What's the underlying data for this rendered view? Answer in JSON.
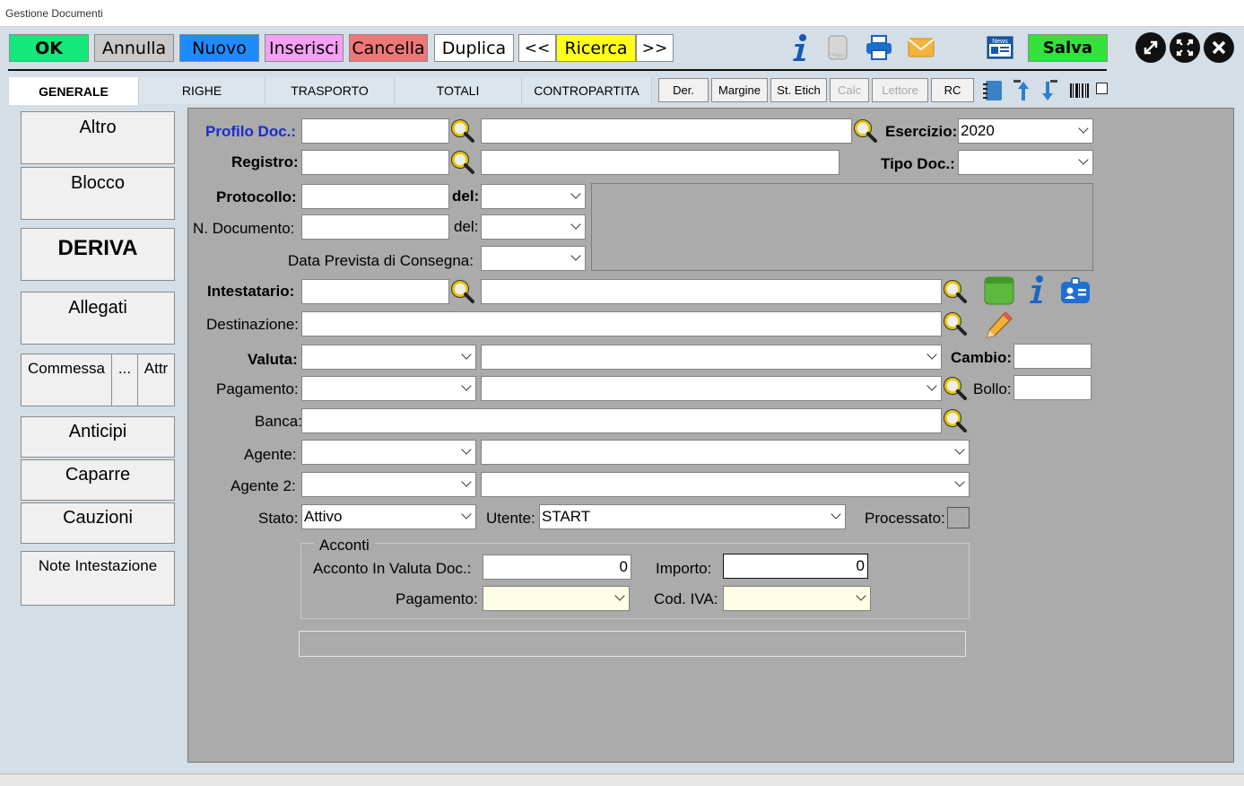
{
  "window": {
    "title": "Gestione Documenti"
  },
  "toolbar": {
    "ok": "OK",
    "annulla": "Annulla",
    "nuovo": "Nuovo",
    "inserisci": "Inserisci",
    "cancella": "Cancella",
    "duplica": "Duplica",
    "prev": "<<",
    "ricerca": "Ricerca",
    "next": ">>",
    "salva": "Salva",
    "news": "News",
    "colors": {
      "ok": "#14e87a",
      "annulla": "#c9c9c9",
      "nuovo": "#1e8bff",
      "inserisci": "#f59ff5",
      "cancella": "#ef7777",
      "ricerca": "#ffff18",
      "salva": "#33e23a"
    }
  },
  "tabs": [
    "GENERALE",
    "RIGHE",
    "TRASPORTO",
    "TOTALI",
    "CONTROPARTITA"
  ],
  "small_buttons": [
    "Der.",
    "Margine",
    "St. Etich",
    "Calc",
    "Lettore",
    "RC"
  ],
  "left_buttons": {
    "altro": "Altro",
    "blocco": "Blocco",
    "deriva": "DERIVA",
    "allegati": "Allegati",
    "commessa": "Commessa",
    "dots": "...",
    "attr": "Attr",
    "anticipi": "Anticipi",
    "caparre": "Caparre",
    "cauzioni": "Cauzioni",
    "note": "Note Intestazione"
  },
  "form": {
    "profilo_doc": "Profilo Doc.:",
    "esercizio": "Esercizio:",
    "esercizio_value": "2020",
    "registro": "Registro:",
    "tipo_doc": "Tipo Doc.:",
    "protocollo": "Protocollo:",
    "del_bold": "del:",
    "n_documento": "N. Documento:",
    "del": "del:",
    "data_prevista": "Data Prevista di Consegna:",
    "intestatario": "Intestatario:",
    "destinazione": "Destinazione:",
    "valuta": "Valuta:",
    "cambio": "Cambio:",
    "pagamento": "Pagamento:",
    "bollo": "Bollo:",
    "banca": "Banca:",
    "agente": "Agente:",
    "agente2": "Agente 2:",
    "stato": "Stato:",
    "stato_value": "Attivo",
    "utente": "Utente:",
    "utente_value": "START",
    "processato": "Processato:"
  },
  "acconti": {
    "title": "Acconti",
    "acconto_label": "Acconto In Valuta Doc.:",
    "acconto_value": "0",
    "importo_label": "Importo:",
    "importo_value": "0",
    "pagamento_label": "Pagamento:",
    "cod_iva_label": "Cod. IVA:"
  }
}
